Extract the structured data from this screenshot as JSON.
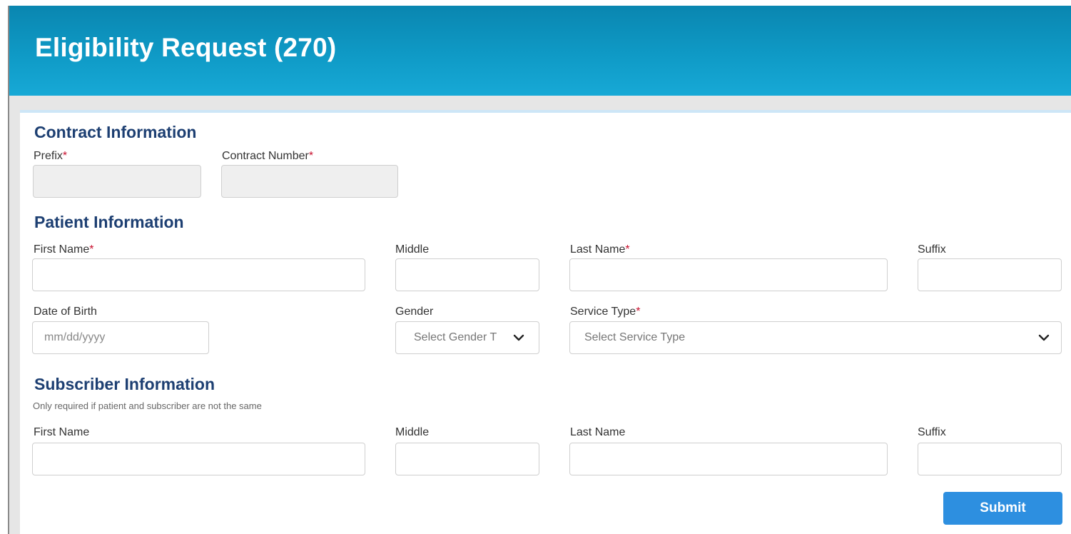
{
  "header": {
    "title": "Eligibility Request (270)"
  },
  "contract": {
    "title": "Contract Information",
    "prefix_label": "Prefix",
    "contract_number_label": "Contract Number",
    "required_mark": "*"
  },
  "patient": {
    "title": "Patient Information",
    "first_name_label": "First Name",
    "middle_label": "Middle",
    "last_name_label": "Last Name",
    "suffix_label": "Suffix",
    "dob_label": "Date of Birth",
    "dob_placeholder": "mm/dd/yyyy",
    "gender_label": "Gender",
    "gender_placeholder": "Select Gender T",
    "service_type_label": "Service Type",
    "service_type_placeholder": "Select Service Type",
    "required_mark": "*"
  },
  "subscriber": {
    "title": "Subscriber Information",
    "note": "Only required if patient and subscriber are not the same",
    "first_name_label": "First Name",
    "middle_label": "Middle",
    "last_name_label": "Last Name",
    "suffix_label": "Suffix"
  },
  "actions": {
    "submit_label": "Submit"
  },
  "colors": {
    "header": "#0f9ac6",
    "section_title": "#1d3f72",
    "required": "#c8102e",
    "button": "#2d8fe0"
  }
}
